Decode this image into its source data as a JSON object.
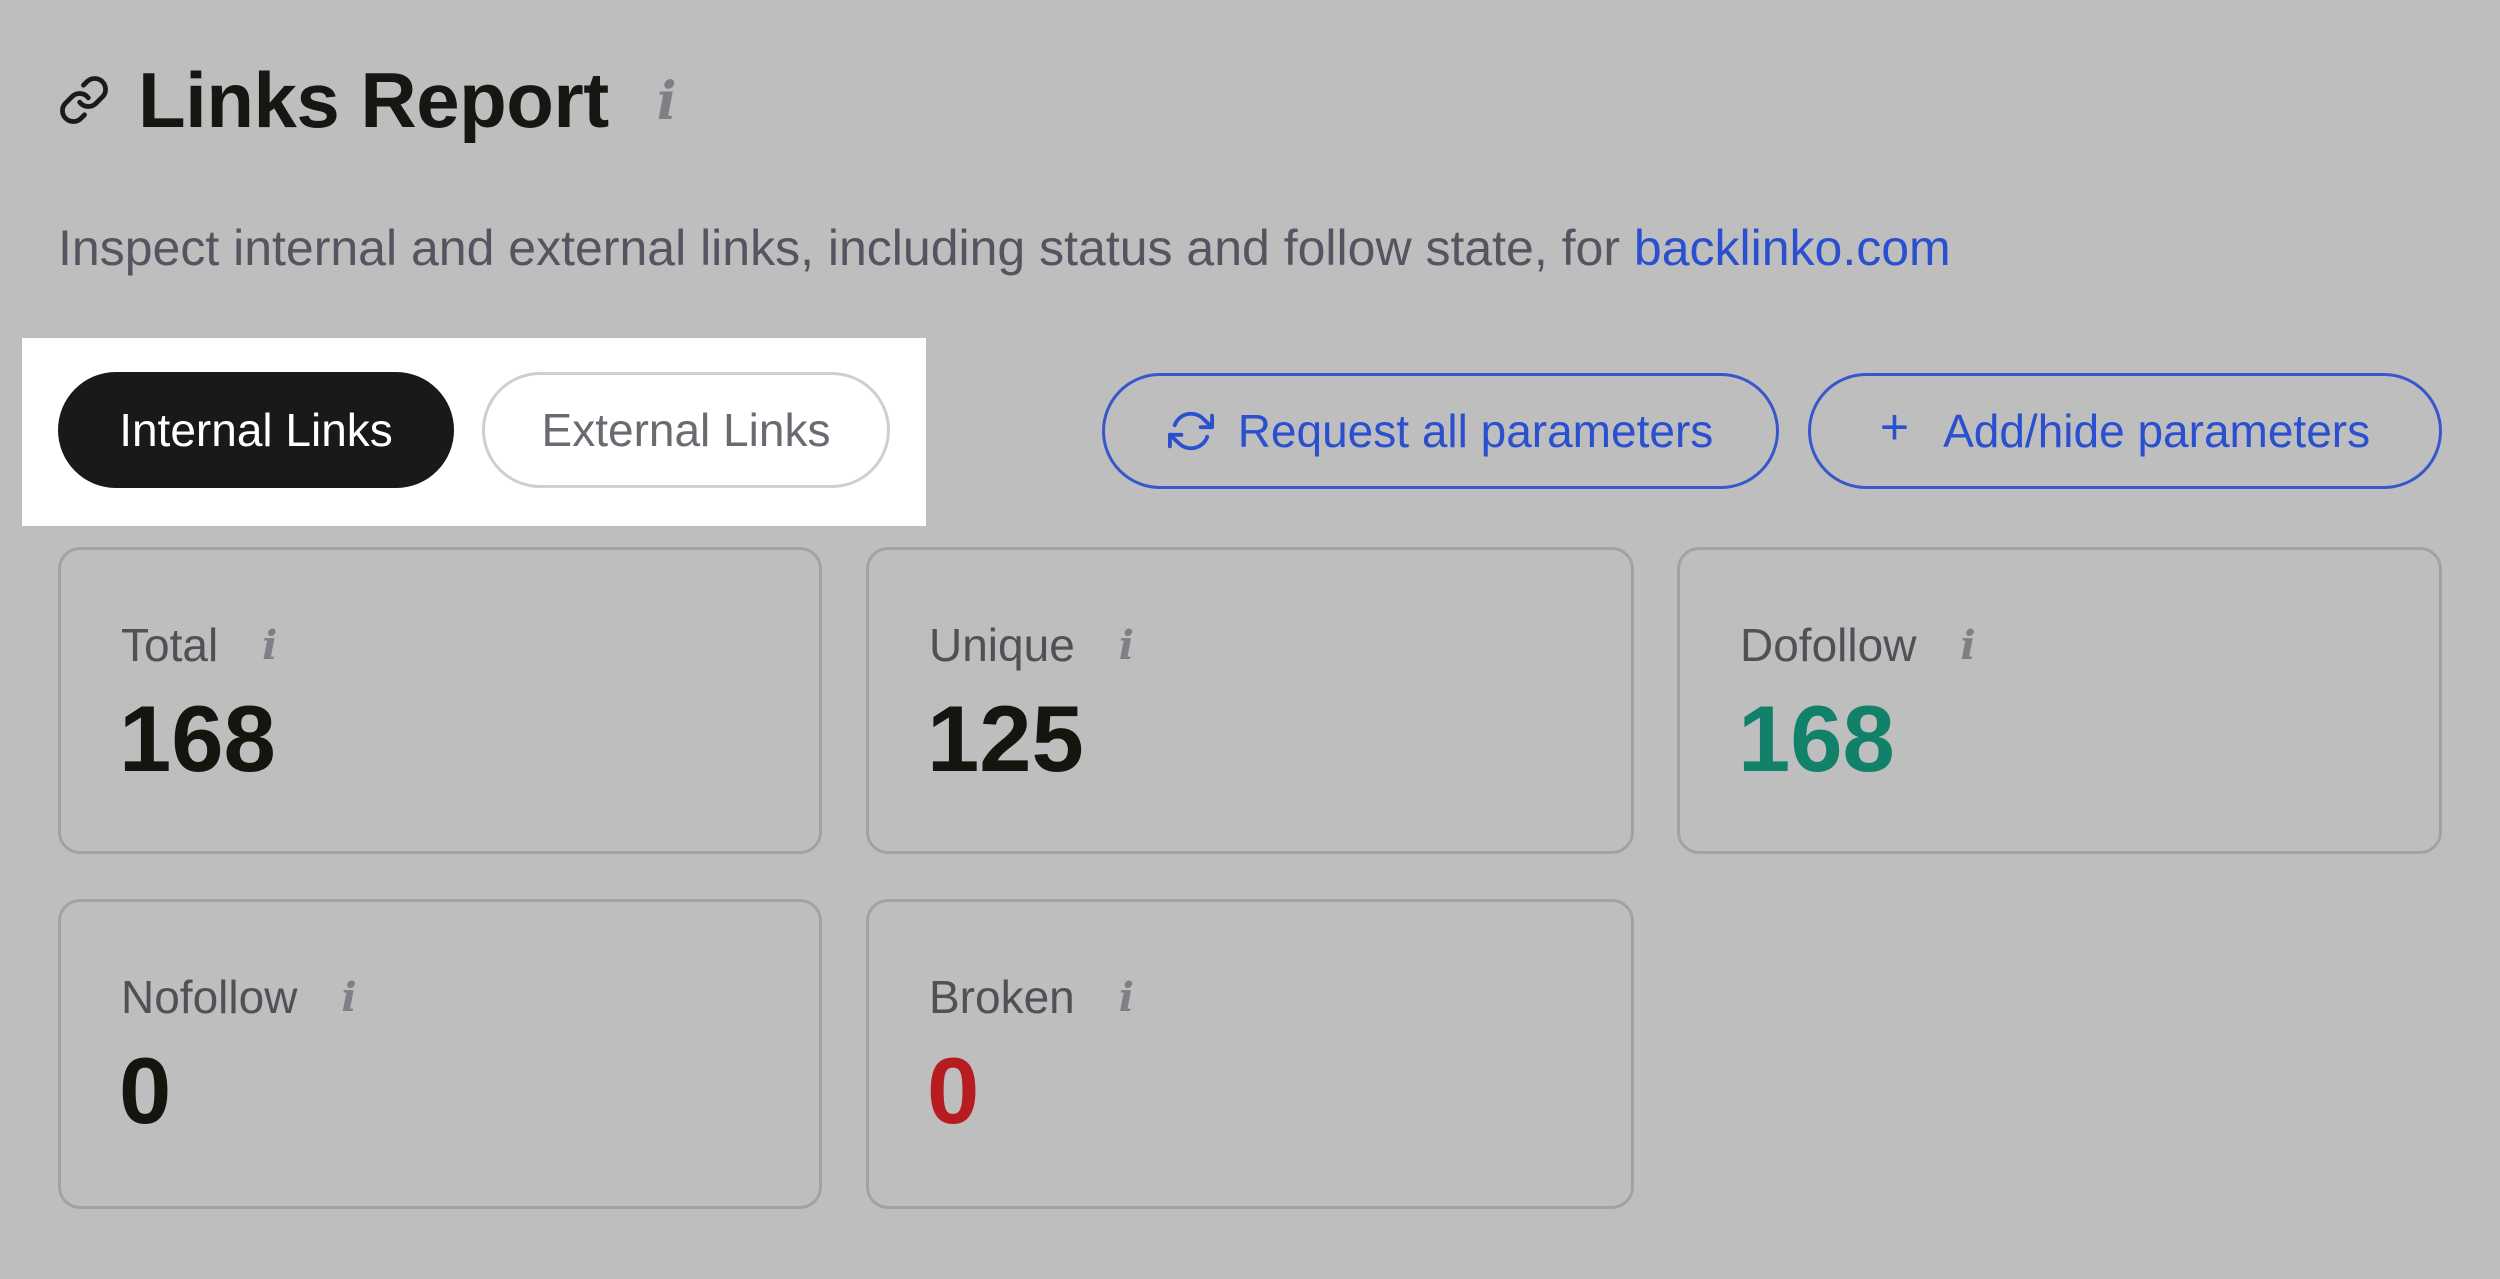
{
  "header": {
    "title": "Links Report",
    "info_icon": "i"
  },
  "subtitle": {
    "text": "Inspect internal and external links, including status and follow state, for ",
    "domain": "backlinko.com"
  },
  "tabs": [
    {
      "label": "Internal Links",
      "active": true
    },
    {
      "label": "External Links",
      "active": false
    }
  ],
  "toolbar": {
    "request_label": "Request all parameters",
    "add_hide_label": "Add/hide parameters",
    "plus_symbol": "+"
  },
  "metrics": [
    {
      "label": "Total",
      "value": "168",
      "color": "#14150f"
    },
    {
      "label": "Unique",
      "value": "125",
      "color": "#14150f"
    },
    {
      "label": "Dofollow",
      "value": "168",
      "color": "#128169"
    },
    {
      "label": "Nofollow",
      "value": "0",
      "color": "#14150f"
    },
    {
      "label": "Broken",
      "value": "0",
      "color": "#b71d20"
    }
  ],
  "colors": {
    "accent": "#2a4fcf",
    "active_tab_bg": "#171a16",
    "background": "#bebebe",
    "highlight": "#ffffff"
  },
  "icons": {
    "title": "link-icon",
    "info": "info-icon",
    "request": "refresh-icon",
    "add": "plus-icon"
  }
}
